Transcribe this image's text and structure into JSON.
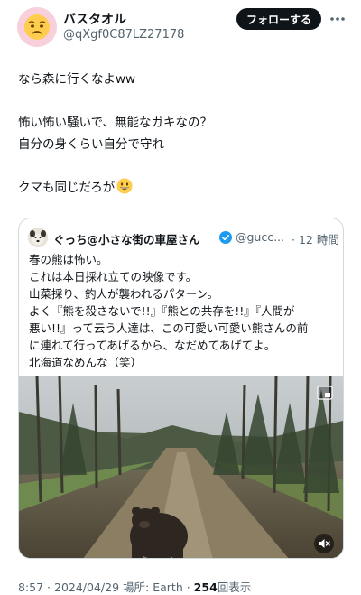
{
  "tweet": {
    "display_name": "バスタオル",
    "handle": "@qXgf0C87LZ27178",
    "follow_label": "フォローする",
    "avatar_icon": "worried-face-emoji",
    "lines": [
      "なら森に行くなよww",
      "",
      "怖い怖い騒いで、無能なガキなの？",
      "自分の身くらい自分で守れ",
      "",
      "クマも同じだろが"
    ],
    "trailing_emoji": "grinning-face-emoji"
  },
  "quote": {
    "display_name": "ぐっち@小さな街の車屋さん",
    "verified_icon": "verified-badge-icon",
    "handle": "@gucc...",
    "time": "· 12 時間",
    "lines": [
      "春の熊は怖い。",
      "これは本日採れ立ての映像です。",
      "山菜採り、釣人が襲われるパターン。",
      "よく『熊を殺さないで!!』『熊との共存を!!』『人間が",
      "悪い!!』って云う人達は、この可愛い可愛い熊さんの前",
      "に連れて行ってあげるから、なだめてあげてよ。",
      "北海道なめんな（笑）"
    ],
    "media_icon": "video-thumbnail",
    "mute_icon": "mute-icon"
  },
  "meta": {
    "time_date": "8:57 · 2024/04/29",
    "location": "場所: Earth ·",
    "views_count": "254",
    "views_label": "回表示"
  },
  "colors": {
    "text": "#0f1419",
    "secondary": "#536471",
    "border": "#cfd9de",
    "button_bg": "#0f1419",
    "verified": "#1d9bf0",
    "avatar_bg": "#f7d0dc"
  }
}
